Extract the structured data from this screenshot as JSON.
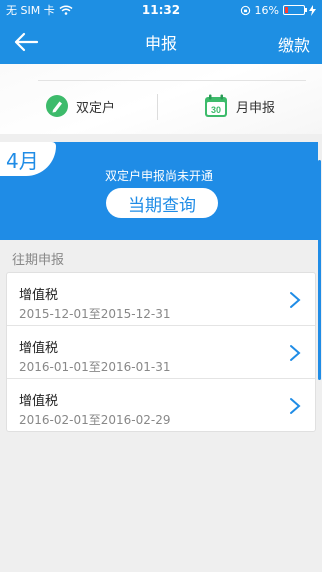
{
  "status_bar": {
    "carrier": "无 SIM 卡",
    "time": "11:32",
    "battery": "16%",
    "battery_level": 0.16
  },
  "nav": {
    "title": "申报",
    "action_label": "缴款",
    "back_icon": "arrow-left-icon"
  },
  "options": [
    {
      "label": "双定户",
      "icon": "pen-icon"
    },
    {
      "label": "月申报",
      "icon": "calendar-30-icon"
    }
  ],
  "banner": {
    "month": "4月",
    "message": "双定户申报尚未开通",
    "button_label": "当期查询"
  },
  "history": {
    "header": "往期申报",
    "items": [
      {
        "title": "增值税",
        "range": "2015-12-01至2015-12-31"
      },
      {
        "title": "增值税",
        "range": "2016-01-01至2016-01-31"
      },
      {
        "title": "增值税",
        "range": "2016-02-01至2016-02-29"
      }
    ]
  },
  "colors": {
    "primary": "#1e8fe3",
    "option_icon_green": "#3dbb6b"
  }
}
